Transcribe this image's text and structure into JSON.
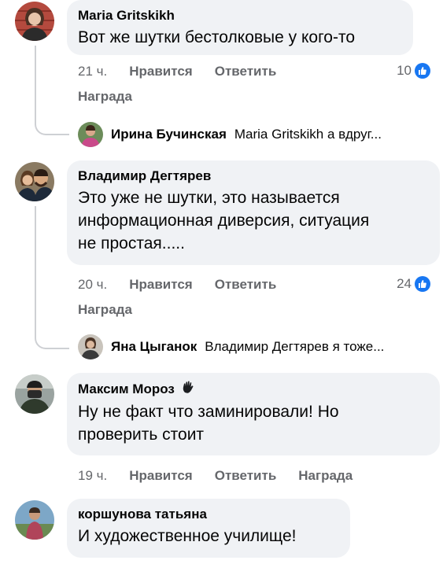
{
  "comments": [
    {
      "author": "Maria Gritskikh",
      "text": "Вот же шутки бестолковые у кого-то",
      "time": "21 ч.",
      "like": "Нравится",
      "reply": "Ответить",
      "award": "Награда",
      "reactions": "10",
      "reply_preview": {
        "name": "Ирина Бучинская",
        "text": "Maria Gritskikh а вдруг..."
      }
    },
    {
      "author": "Владимир Дегтярев",
      "text_lines": [
        "Это уже не шутки, это называется",
        "информационная диверсия, ситуация",
        "не простая....."
      ],
      "time": "20 ч.",
      "like": "Нравится",
      "reply": "Ответить",
      "award": "Награда",
      "reactions": "24",
      "reply_preview": {
        "name": "Яна Цыганок",
        "text": "Владимир Дегтярев я тоже..."
      }
    },
    {
      "author": "Максим Мороз",
      "badge_icon": "waving-hand-icon",
      "text_lines": [
        "Ну не факт что заминировали! Но",
        "проверить стоит"
      ],
      "time": "19 ч.",
      "like": "Нравится",
      "reply": "Ответить",
      "award": "Награда"
    },
    {
      "author": "коршунова татьяна",
      "text": "И художественное училище!"
    }
  ],
  "colors": {
    "bubble": "#f0f2f5",
    "meta": "#65676b",
    "like": "#1877f2",
    "line": "#ced0d4"
  }
}
